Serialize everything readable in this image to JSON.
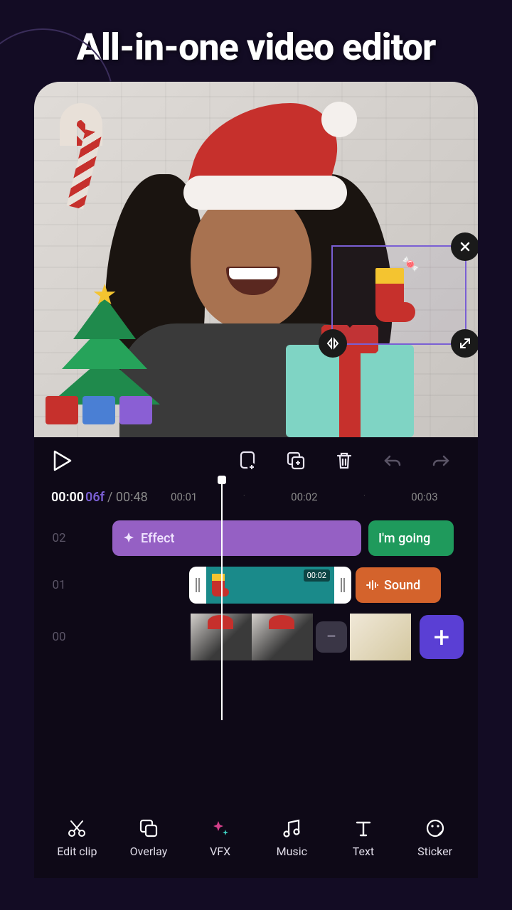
{
  "headline": "All-in-one video editor",
  "preview": {
    "stickers": {
      "candy_cane": "candy-cane",
      "tree": "christmas-tree",
      "stocking": "stocking"
    },
    "selection_handles": {
      "close": "close",
      "flip": "flip-horizontal",
      "resize": "resize"
    }
  },
  "controls": {
    "play": "play",
    "add_to": "add-to",
    "duplicate": "duplicate",
    "delete": "delete",
    "undo": "undo",
    "redo": "redo"
  },
  "time": {
    "current": "00:00",
    "frame": "06f",
    "total": "/ 00:48",
    "ticks": [
      "00:01",
      "·",
      "00:02",
      "·",
      "00:03"
    ]
  },
  "tracks": {
    "t2": {
      "num": "02",
      "effect_label": "Effect",
      "going_label": "I'm going"
    },
    "t1": {
      "num": "01",
      "sticker_time": "00:02",
      "sound_label": "Sound"
    },
    "t0": {
      "num": "00"
    }
  },
  "tools": [
    {
      "id": "edit-clip",
      "label": "Edit clip",
      "icon": "scissors"
    },
    {
      "id": "overlay",
      "label": "Overlay",
      "icon": "overlay"
    },
    {
      "id": "vfx",
      "label": "VFX",
      "icon": "sparkle"
    },
    {
      "id": "music",
      "label": "Music",
      "icon": "music"
    },
    {
      "id": "text",
      "label": "Text",
      "icon": "text"
    },
    {
      "id": "sticker",
      "label": "Sticker",
      "icon": "sticker"
    }
  ]
}
